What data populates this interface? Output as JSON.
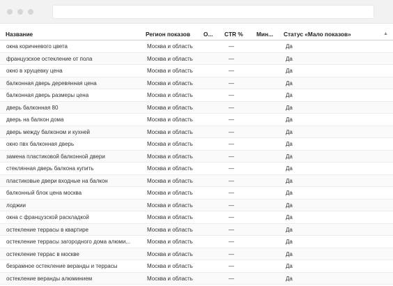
{
  "table": {
    "columns": [
      "Название",
      "Регион показов",
      "О...",
      "CTR %",
      "Мин...",
      "Статус «Мало показов»"
    ],
    "rows": [
      {
        "name": "окна коричневого цвета",
        "region": "Москва и область",
        "ctr": "—",
        "status": "Да"
      },
      {
        "name": "французское остекление от пола",
        "region": "Москва и область",
        "ctr": "—",
        "status": "Да"
      },
      {
        "name": "окно в хрущевку цена",
        "region": "Москва и область",
        "ctr": "—",
        "status": "Да"
      },
      {
        "name": "балконная дверь деревянная цена",
        "region": "Москва и область",
        "ctr": "—",
        "status": "Да"
      },
      {
        "name": "балконная дверь размеры цена",
        "region": "Москва и область",
        "ctr": "—",
        "status": "Да"
      },
      {
        "name": "дверь балконная 80",
        "region": "Москва и область",
        "ctr": "—",
        "status": "Да"
      },
      {
        "name": "дверь на балкон дома",
        "region": "Москва и область",
        "ctr": "—",
        "status": "Да"
      },
      {
        "name": "дверь между балконом и кухней",
        "region": "Москва и область",
        "ctr": "—",
        "status": "Да"
      },
      {
        "name": "окно пвх балконная дверь",
        "region": "Москва и область",
        "ctr": "—",
        "status": "Да"
      },
      {
        "name": "замена пластиковой балконной двери",
        "region": "Москва и область",
        "ctr": "—",
        "status": "Да"
      },
      {
        "name": "стеклянная дверь балкона купить",
        "region": "Москва и область",
        "ctr": "—",
        "status": "Да"
      },
      {
        "name": "пластиковые двери входные на балкон",
        "region": "Москва и область",
        "ctr": "—",
        "status": "Да"
      },
      {
        "name": "балконный блок цена москва",
        "region": "Москва и область",
        "ctr": "—",
        "status": "Да"
      },
      {
        "name": "лоджии",
        "region": "Москва и область",
        "ctr": "—",
        "status": "Да"
      },
      {
        "name": "окна с французской раскладкой",
        "region": "Москва и область",
        "ctr": "—",
        "status": "Да"
      },
      {
        "name": "остекление террасы в квартире",
        "region": "Москва и область",
        "ctr": "—",
        "status": "Да"
      },
      {
        "name": "остекление террасы загородного дома алюми...",
        "region": "Москва и область",
        "ctr": "—",
        "status": "Да"
      },
      {
        "name": "остекление террас в москве",
        "region": "Москва и область",
        "ctr": "—",
        "status": "Да"
      },
      {
        "name": "безрамное остекление веранды и террасы",
        "region": "Москва и область",
        "ctr": "—",
        "status": "Да"
      },
      {
        "name": "остекление веранды алюминием",
        "region": "Москва и область",
        "ctr": "—",
        "status": "Да"
      }
    ]
  }
}
